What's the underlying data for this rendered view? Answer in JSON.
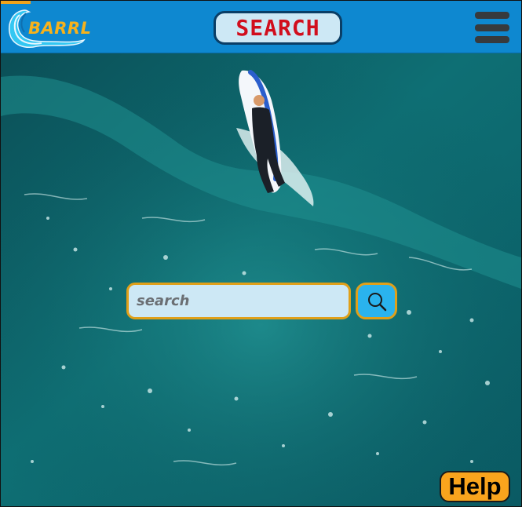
{
  "header": {
    "logo_text": "BARRL",
    "title": "SEARCH",
    "menu_icon": "hamburger-menu-icon"
  },
  "hero": {
    "description": "aerial ocean wave with surfer"
  },
  "search": {
    "placeholder": "search",
    "value": "",
    "button_icon": "search-icon"
  },
  "help": {
    "label": "Help"
  },
  "colors": {
    "header_bg": "#0e88d0",
    "title_text": "#d10e1d",
    "pill_bg": "#cde8f5",
    "accent_orange": "#f0a31c",
    "search_button_bg": "#2ab3ee",
    "help_bg": "#f9a41d"
  }
}
